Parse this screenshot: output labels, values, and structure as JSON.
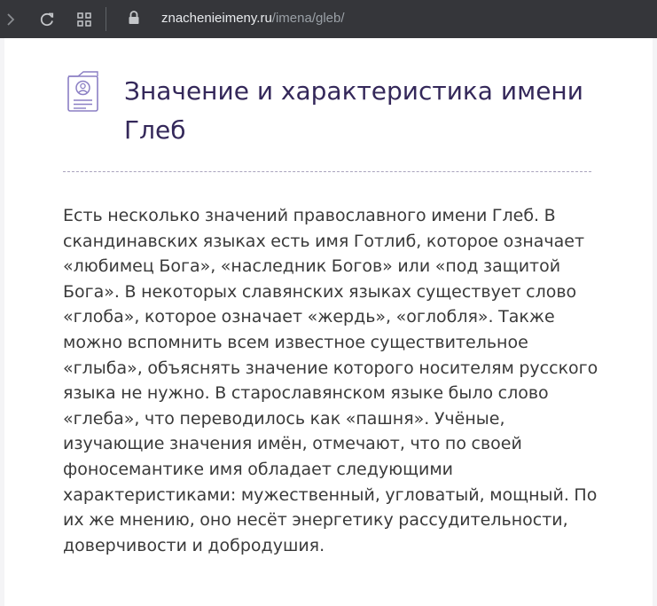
{
  "browser": {
    "url_domain": "znachenieimeny.ru",
    "url_path": "/imena/gleb/",
    "icons": [
      "forward-icon",
      "reload-icon",
      "apps-grid-icon",
      "lock-icon"
    ]
  },
  "article": {
    "icon": "profile-document-icon",
    "title": "Значение и характеристика имени Глеб",
    "body": "Есть несколько значений православного имени Глеб. В скандинавских языках есть имя Готлиб, которое означает «любимец Бога», «наследник Богов» или «под защитой Бога». В некоторых славянских языках существует слово «глоба», которое означает «жердь», «оглобля». Также можно вспомнить всем известное существительное «глыба», объяснять значение которого носителям русского языка не нужно. В старославянском языке было слово «глеба», что переводилось как «пашня». Учёные, изучающие значения имён, отмечают, что по своей фоносемантике имя обладает следующими характеристиками: мужественный, угловатый, мощный. По их же мнению, оно несёт энергетику рассудительности, доверчивости и добродушия."
  },
  "colors": {
    "toolbar": "#35363a",
    "title": "#34285a",
    "text": "#3a3a3a",
    "icon_accent": "#8b7fc4"
  }
}
